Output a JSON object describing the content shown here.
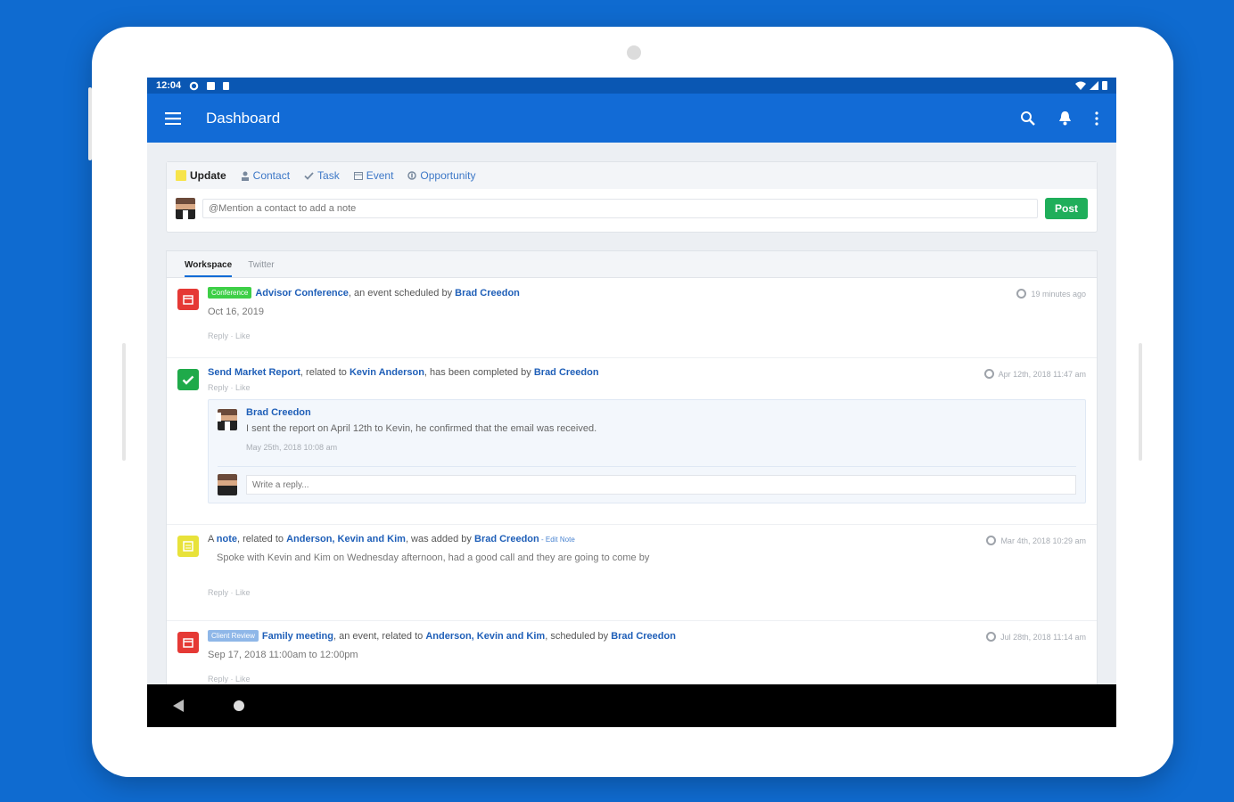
{
  "statusbar": {
    "time": "12:04"
  },
  "appbar": {
    "title": "Dashboard"
  },
  "composer": {
    "tabs": [
      {
        "label": "Update",
        "icon": "update-square-icon"
      },
      {
        "label": "Contact",
        "icon": "person-icon"
      },
      {
        "label": "Task",
        "icon": "check-icon"
      },
      {
        "label": "Event",
        "icon": "calendar-icon"
      },
      {
        "label": "Opportunity",
        "icon": "dollar-icon"
      }
    ],
    "placeholder": "@Mention a contact to add a note",
    "post_label": "Post"
  },
  "feed": {
    "tabs": [
      "Workspace",
      "Twitter"
    ],
    "items": [
      {
        "badge": "Conference",
        "badge_color": "#3ecf47",
        "title": "Advisor Conference",
        "text1": ", an event scheduled by ",
        "owner": "Brad Creedon",
        "date": "Oct 16, 2019",
        "time": "19 minutes ago",
        "actions": "Reply · Like",
        "tile_color": "#e53935"
      },
      {
        "title": "Send Market Report",
        "text1": ", related to ",
        "contact": "Kevin Anderson",
        "text2": ", has been completed by ",
        "owner": "Brad Creedon",
        "time": "Apr 12th, 2018 11:47 am",
        "actions": "Reply · Like",
        "tile_color": "#1faa4a",
        "comment": {
          "author": "Brad Creedon",
          "text": "I sent the report on April 12th to Kevin, he confirmed that the email was received.",
          "time": "May 25th, 2018 10:08 am",
          "reply_placeholder": "Write a reply..."
        }
      },
      {
        "prefix": "A ",
        "title": "note",
        "text1": ", related to ",
        "contact": "Anderson, Kevin and Kim",
        "text2": ", was added by ",
        "owner": "Brad Creedon",
        "edit": " - Edit Note",
        "body": "Spoke with Kevin and Kim on Wednesday afternoon, had a good call and they are going to come by",
        "time": "Mar 4th, 2018 10:29 am",
        "actions": "Reply · Like",
        "tile_color": "#e8e23a"
      },
      {
        "badge": "Client Review",
        "badge_color": "#8fb7e8",
        "title": "Family meeting",
        "text1": ", an event, related to ",
        "contact": "Anderson, Kevin and Kim",
        "text2": ", scheduled by ",
        "owner": "Brad Creedon",
        "date": "Sep 17, 2018 11:00am to 12:00pm",
        "time": "Jul 28th, 2018 11:14 am",
        "actions": "Reply · Like",
        "tile_color": "#e53935"
      }
    ]
  }
}
